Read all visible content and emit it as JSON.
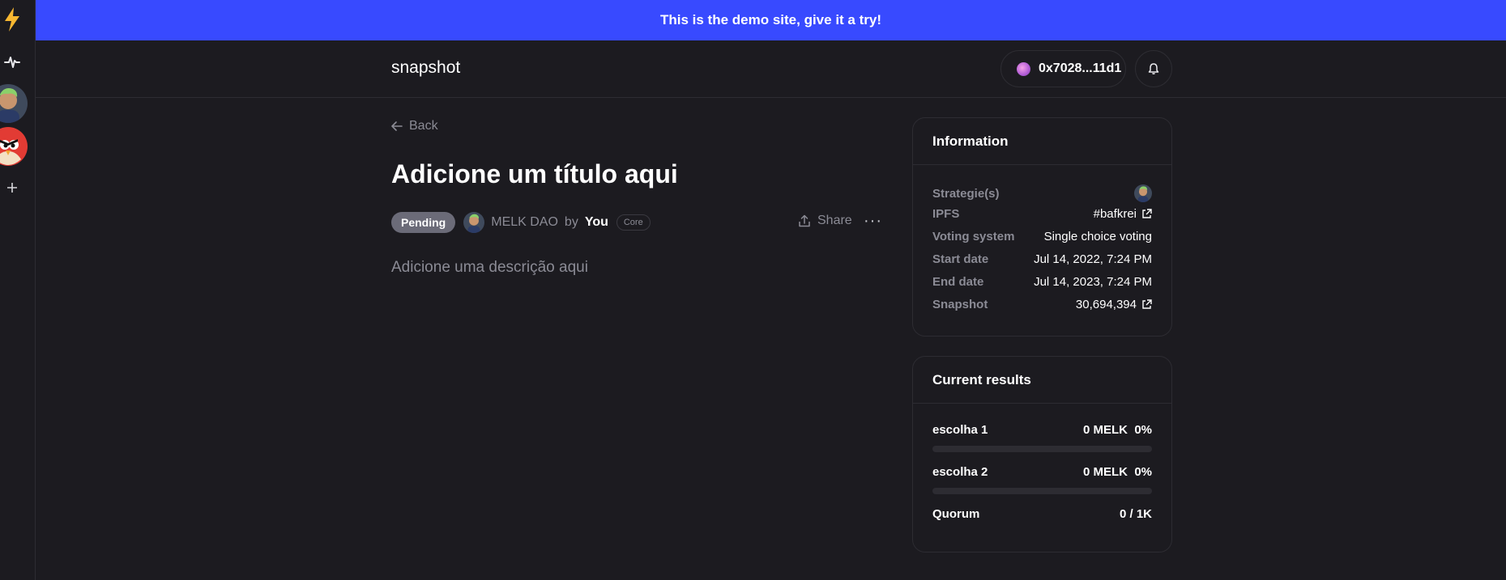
{
  "banner": {
    "text": "This is the demo site, give it a try!"
  },
  "rail": {
    "logo_icon": "lightning-icon",
    "activity_icon": "activity-icon",
    "spaces": [
      "avatar-space-1",
      "avatar-space-2"
    ],
    "add_icon": "plus-icon"
  },
  "nav": {
    "brand": "snapshot",
    "account": "0x7028...11d1",
    "bell_icon": "bell-icon"
  },
  "proposal": {
    "back_label": "Back",
    "title": "Adicione um título aqui",
    "status": "Pending",
    "space_name": "MELK DAO",
    "by_label": "by",
    "author": "You",
    "author_badge": "Core",
    "share_label": "Share",
    "more_label": "···",
    "description": "Adicione uma descrição aqui"
  },
  "information": {
    "title": "Information",
    "rows": [
      {
        "label": "Strategie(s)",
        "value": ""
      },
      {
        "label": "IPFS",
        "value": "#bafkrei"
      },
      {
        "label": "Voting system",
        "value": "Single choice voting"
      },
      {
        "label": "Start date",
        "value": "Jul 14, 2022, 7:24 PM"
      },
      {
        "label": "End date",
        "value": "Jul 14, 2023, 7:24 PM"
      },
      {
        "label": "Snapshot",
        "value": "30,694,394"
      }
    ]
  },
  "results": {
    "title": "Current results",
    "choices": [
      {
        "name": "escolha 1",
        "amount": "0 MELK",
        "percent": "0%",
        "fraction": 0
      },
      {
        "name": "escolha 2",
        "amount": "0 MELK",
        "percent": "0%",
        "fraction": 0
      }
    ],
    "quorum_label": "Quorum",
    "quorum_value": "0 / 1K"
  },
  "colors": {
    "accent": "#384aff",
    "background": "#1c1b20",
    "border": "#2d2c32",
    "muted_text": "#8b8b95",
    "pending_badge": "#6b6b78"
  }
}
